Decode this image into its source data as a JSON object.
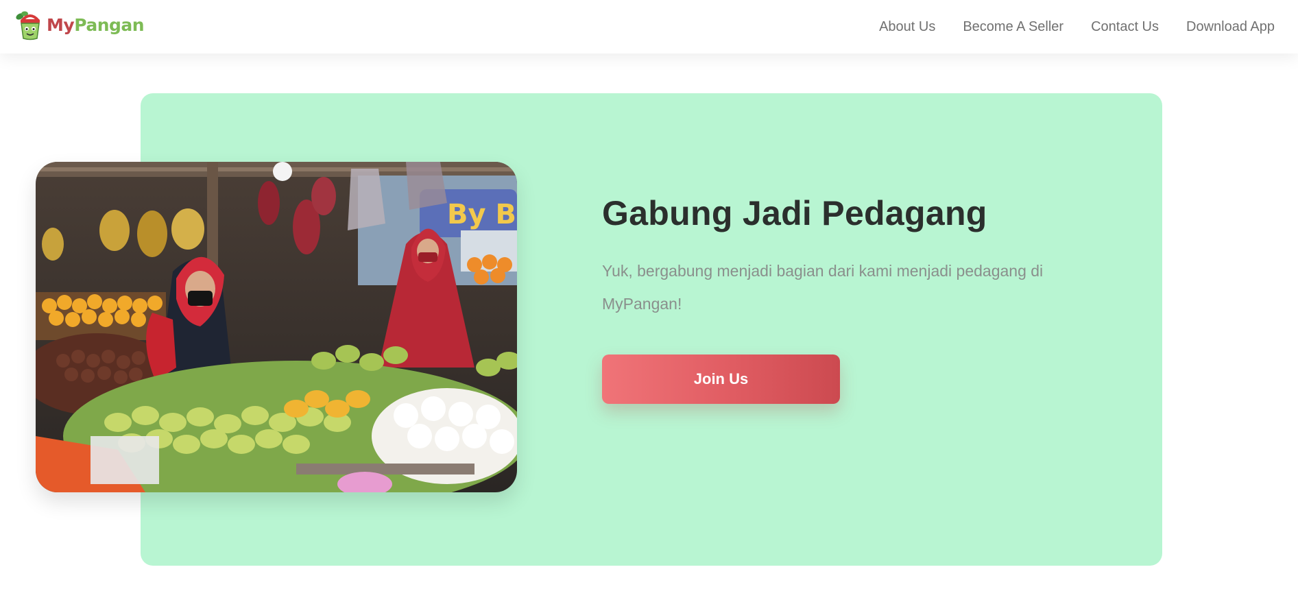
{
  "brand": {
    "name_part1": "My",
    "name_part2": "Pangan",
    "logo_icon": "basket-mascot-icon",
    "colors": {
      "my": "#c0464b",
      "pangan": "#7dbb55"
    }
  },
  "nav": {
    "items": [
      {
        "label": "About Us"
      },
      {
        "label": "Become A Seller"
      },
      {
        "label": "Contact Us"
      },
      {
        "label": "Download App"
      }
    ]
  },
  "hero": {
    "title": "Gabung Jadi Pedagang",
    "description": "Yuk, bergabung menjadi bagian dari kami menjadi pedagang di MyPangan!",
    "button_label": "Join Us",
    "image_icon": "market-vendors-photo",
    "colors": {
      "card_background": "#b8f5d2",
      "button_start": "#f07478",
      "button_end": "#cc4a50",
      "title": "#2b2f2d",
      "description": "#8a8f8c"
    }
  }
}
